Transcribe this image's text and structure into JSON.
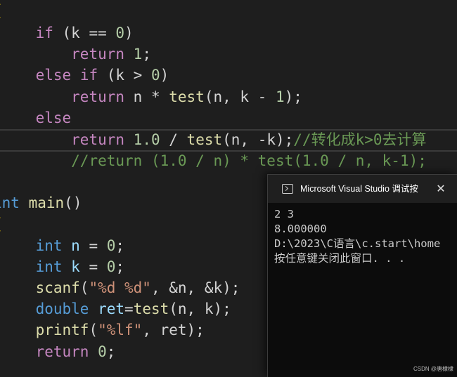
{
  "editor": {
    "lines": {
      "l0": {
        "brace": "{"
      },
      "l1": {
        "kw": "if",
        "p1": " (k == ",
        "n": "0",
        "p2": ")"
      },
      "l2": {
        "kw": "return",
        "n": "1",
        "p": ";"
      },
      "l3": {
        "kw1": "else",
        "kw2": "if",
        "p1": " (k > ",
        "n": "0",
        "p2": ")"
      },
      "l4": {
        "kw": "return",
        "p1": " n * ",
        "fn": "test",
        "p2": "(n, k - ",
        "n": "1",
        "p3": ");"
      },
      "l5": {
        "kw": "else"
      },
      "l6": {
        "kw": "return",
        "n": "1.0",
        "p1": " / ",
        "fn": "test",
        "p2": "(n, -k);",
        "cm": "//转化成k>0去计算"
      },
      "l7": {
        "cm": "//return (1.0 / n) * test(1.0 / n, k-1);"
      },
      "l8": {
        "ty": "int",
        "fn": "main",
        "p": "()"
      },
      "l9": {
        "brace": "{"
      },
      "l10": {
        "ty": "int",
        "var": "n",
        "p1": " = ",
        "n": "0",
        "p2": ";"
      },
      "l11": {
        "ty": "int",
        "var": "k",
        "p1": " = ",
        "n": "0",
        "p2": ";"
      },
      "l12": {
        "fn": "scanf",
        "p1": "(",
        "str": "\"%d %d\"",
        "p2": ", &n, &k);"
      },
      "l13": {
        "ty": "double",
        "var": "ret",
        "p1": "=",
        "fn": "test",
        "p2": "(n, k);"
      },
      "l14": {
        "fn": "printf",
        "p1": "(",
        "str": "\"%lf\"",
        "p2": ", ret);"
      },
      "l15": {
        "kw": "return",
        "n": "0",
        "p": ";"
      }
    }
  },
  "console": {
    "title": "Microsoft Visual Studio 调试按",
    "close_glyph": "✕",
    "output": [
      "2 3",
      "8.000000",
      "D:\\2023\\C语言\\c.start\\home",
      "按任意键关闭此窗口. . ."
    ]
  },
  "watermark": "CSDN @唐棣棣"
}
